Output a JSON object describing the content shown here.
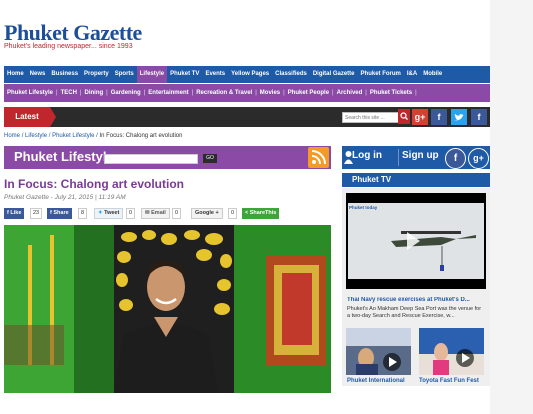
{
  "header": {
    "logo": "Phuket Gazette",
    "tagline": "Phuket's leading newspaper... since 1993"
  },
  "nav_main": [
    "Home",
    "News",
    "Business",
    "Property",
    "Sports",
    "Lifestyle",
    "Phuket TV",
    "Events",
    "Yellow Pages",
    "Classifieds",
    "Digital Gazette",
    "Phuket Forum",
    "I&A",
    "Mobile"
  ],
  "nav_main_active": "Lifestyle",
  "nav_sub": [
    "Phuket Lifestyle",
    "TECH",
    "Dining",
    "Gardening",
    "Entertainment",
    "Recreation & Travel",
    "Movies",
    "Phuket People",
    "Archived",
    "Phuket Tickets"
  ],
  "latest": {
    "label": "Latest",
    "search_placeholder": "Search this site ..."
  },
  "breadcrumb": {
    "home": "Home",
    "lifestyle": "Lifestyle",
    "phuket_lifestyle": "Phuket Lifestyle",
    "current": "In Focus: Chalong art evolution"
  },
  "section": {
    "title": "Phuket Lifestyle",
    "go": "GO"
  },
  "article": {
    "headline": "In Focus: Chalong art evolution",
    "byline": "Phuket Gazette - July 21, 2015 | 11:19 AM"
  },
  "share": {
    "facebook_like": "Like",
    "like_count": "23",
    "facebook_share": "Share",
    "share_count": "8",
    "tweet": "Tweet",
    "tweet_count": "0",
    "email": "Email",
    "email_count": "0",
    "google": "Google +",
    "google_count": "0",
    "sharethis": "ShareThis"
  },
  "sidebar": {
    "login": "Log in",
    "signup": "Sign up",
    "tv_title": "Phuket TV",
    "video_logo": "Phuket today",
    "video_caption": "Thai Navy rescue exercises at Phuket's D...",
    "video_description": "Phuket's Ao Makham Deep Sea Port was the venue for a two-day Search and Rescue Exercise, w...",
    "thumb1_caption": "Phuket International",
    "thumb2_caption": "Toyota Fast Fun Fest"
  },
  "colors": {
    "brand_blue": "#1f5aa6",
    "lifestyle_purple": "#8a4aa6",
    "accent_red": "#c0272d"
  }
}
